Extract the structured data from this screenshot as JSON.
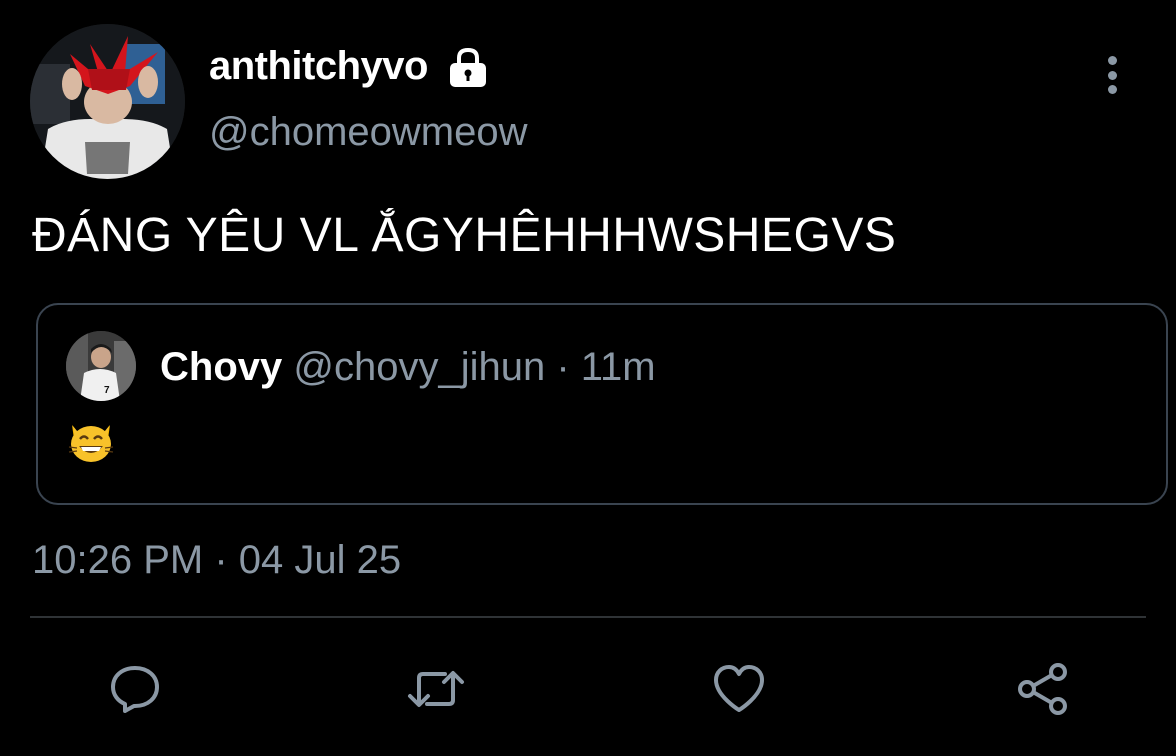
{
  "author": {
    "display_name": "anthitchyvo",
    "handle": "@chomeowmeow",
    "avatar_icon": "avatar-red-mask-player",
    "protected_icon": "lock-icon"
  },
  "tweet": {
    "text": "ĐÁNG YÊU VL ẮGYHÊHHHWSHEGVS",
    "timestamp": "10:26 PM · 04 Jul 25"
  },
  "quote": {
    "name": "Chovy",
    "handle": "@chovy_jihun",
    "separator": " · ",
    "time": "11m",
    "body_icon": "grinning-cat-emoji"
  },
  "actions": {
    "reply_icon": "reply-icon",
    "retweet_icon": "retweet-icon",
    "like_icon": "heart-icon",
    "share_icon": "share-icon"
  },
  "colors": {
    "background": "#000000",
    "text": "#ffffff",
    "muted": "#8b98a5",
    "border": "#3a4450"
  }
}
